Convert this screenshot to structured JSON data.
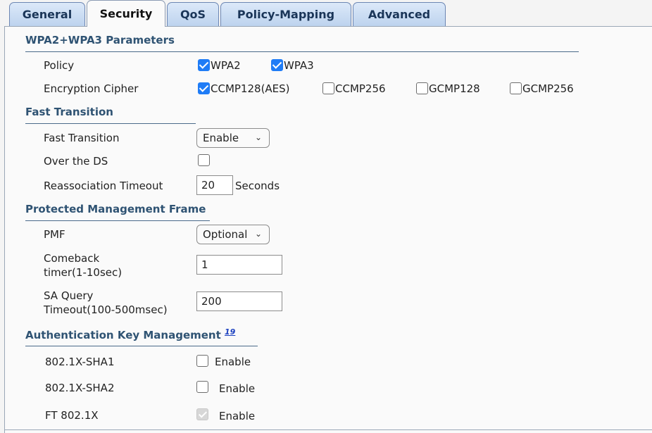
{
  "tabs": [
    {
      "label": "General"
    },
    {
      "label": "Security"
    },
    {
      "label": "QoS"
    },
    {
      "label": "Policy-Mapping"
    },
    {
      "label": "Advanced"
    }
  ],
  "wpa": {
    "title": "WPA2+WPA3 Parameters",
    "policy_label": "Policy",
    "wpa2": "WPA2",
    "wpa3": "WPA3",
    "cipher_label": "Encryption Cipher",
    "ccmp128": "CCMP128(AES)",
    "ccmp256": "CCMP256",
    "gcmp128": "GCMP128",
    "gcmp256": "GCMP256"
  },
  "ft": {
    "title": "Fast Transition",
    "ft_label": "Fast Transition",
    "ft_value": "Enable",
    "over_ds_label": "Over the DS",
    "reassoc_label": "Reassociation Timeout",
    "reassoc_value": "20",
    "seconds": "Seconds"
  },
  "pmf": {
    "title": "Protected Management Frame",
    "pmf_label": "PMF",
    "pmf_value": "Optional",
    "comeback_label_1": "Comeback",
    "comeback_label_2": "timer(1-10sec)",
    "comeback_value": "1",
    "saquery_label_1": "SA Query",
    "saquery_label_2": "Timeout(100-500msec)",
    "saquery_value": "200"
  },
  "akm": {
    "title": "Authentication Key Management",
    "footnote": "19",
    "sha1_label": "802.1X-SHA1",
    "sha2_label": "802.1X-SHA2",
    "ft8021x_label": "FT 802.1X",
    "enable": "Enable"
  },
  "icons": {
    "chevron": "chevron-down-icon",
    "check": "check-icon"
  },
  "colors": {
    "accent": "#1f7cf6",
    "section_title": "#2f5373"
  }
}
